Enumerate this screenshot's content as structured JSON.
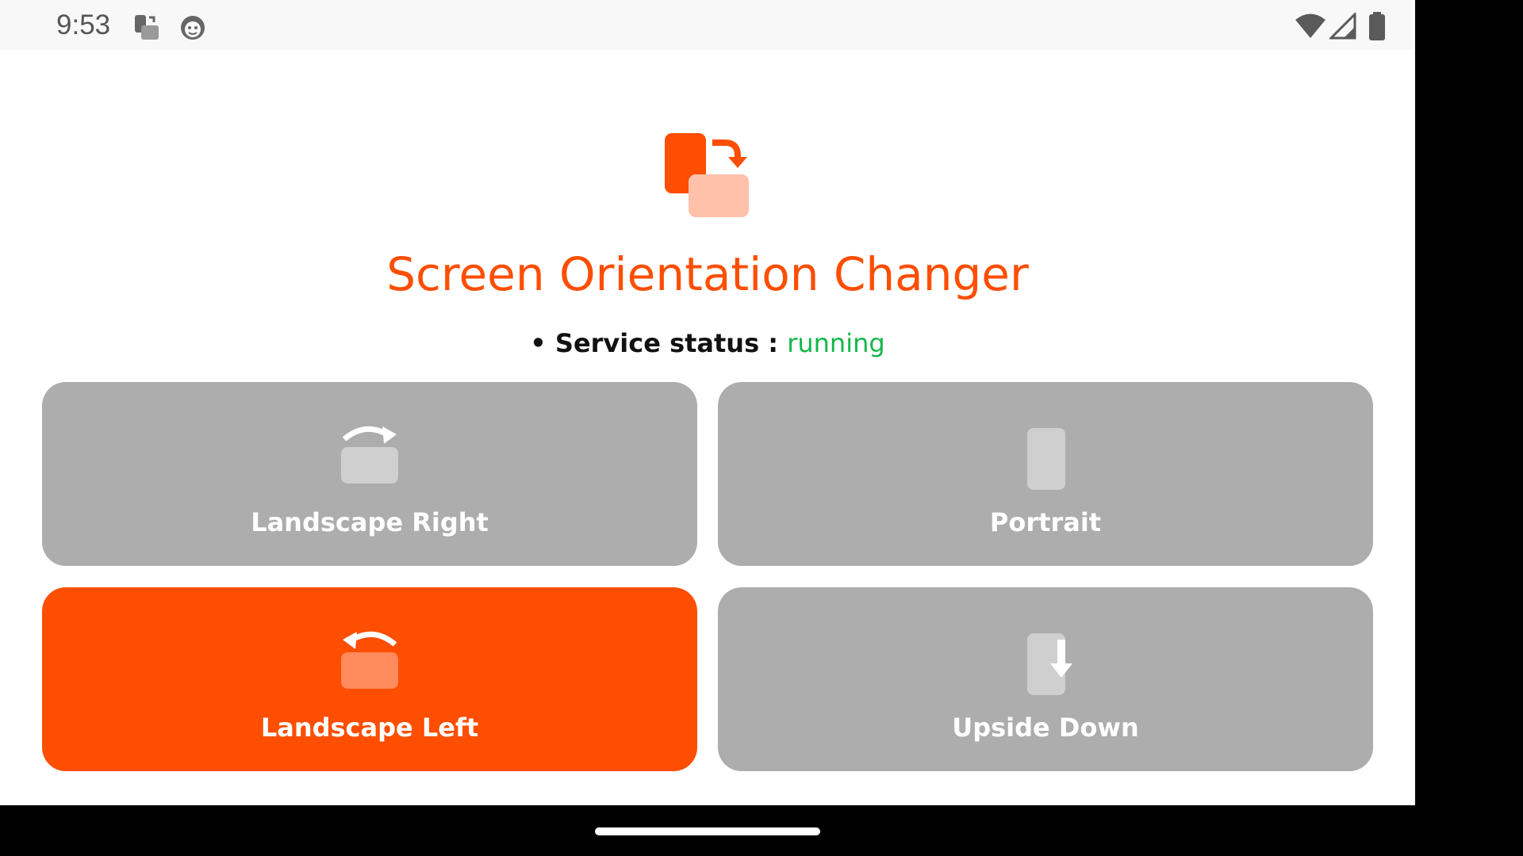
{
  "status_bar": {
    "time": "9:53",
    "icons": [
      "screen-rotation-notification-icon",
      "bot-face-notification-icon",
      "wifi-icon",
      "cell-signal-icon",
      "battery-icon"
    ]
  },
  "app": {
    "title": "Screen Orientation Changer",
    "logo_icon": "screen-rotation-logo-icon",
    "service_status": {
      "prefix": "• Service status : ",
      "value": "running"
    }
  },
  "orientation_buttons": [
    {
      "label": "Landscape Right",
      "icon": "rotate-right-icon",
      "selected": false
    },
    {
      "label": "Portrait",
      "icon": "portrait-icon",
      "selected": false
    },
    {
      "label": "Landscape Left",
      "icon": "rotate-left-icon",
      "selected": true
    },
    {
      "label": "Upside Down",
      "icon": "upside-down-icon",
      "selected": false
    }
  ],
  "colors": {
    "accent": "#fe4e02",
    "accent_light": "#ffc1aa",
    "button_inactive": "#adadad",
    "button_icon_inactive": "#cfcfcf",
    "status_running": "#14b84a"
  }
}
